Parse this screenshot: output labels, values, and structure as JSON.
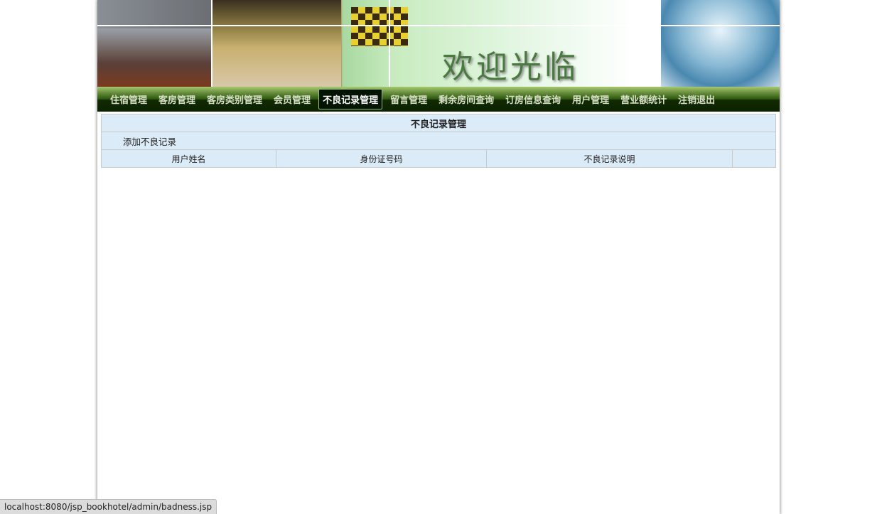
{
  "banner": {
    "welcome_text": "欢迎光临"
  },
  "nav": {
    "items": [
      {
        "label": "住宿管理"
      },
      {
        "label": "客房管理"
      },
      {
        "label": "客房类别管理"
      },
      {
        "label": "会员管理"
      },
      {
        "label": "不良记录管理",
        "active": true
      },
      {
        "label": "留言管理"
      },
      {
        "label": "剩余房间查询"
      },
      {
        "label": "订房信息查询"
      },
      {
        "label": "用户管理"
      },
      {
        "label": "营业额统计"
      },
      {
        "label": "注销退出"
      }
    ]
  },
  "main": {
    "title": "不良记录管理",
    "add_link": "添加不良记录",
    "columns": [
      "用户姓名",
      "身份证号码",
      "不良记录说明",
      ""
    ]
  },
  "status_bar": {
    "url": "localhost:8080/jsp_bookhotel/admin/badness.jsp"
  }
}
